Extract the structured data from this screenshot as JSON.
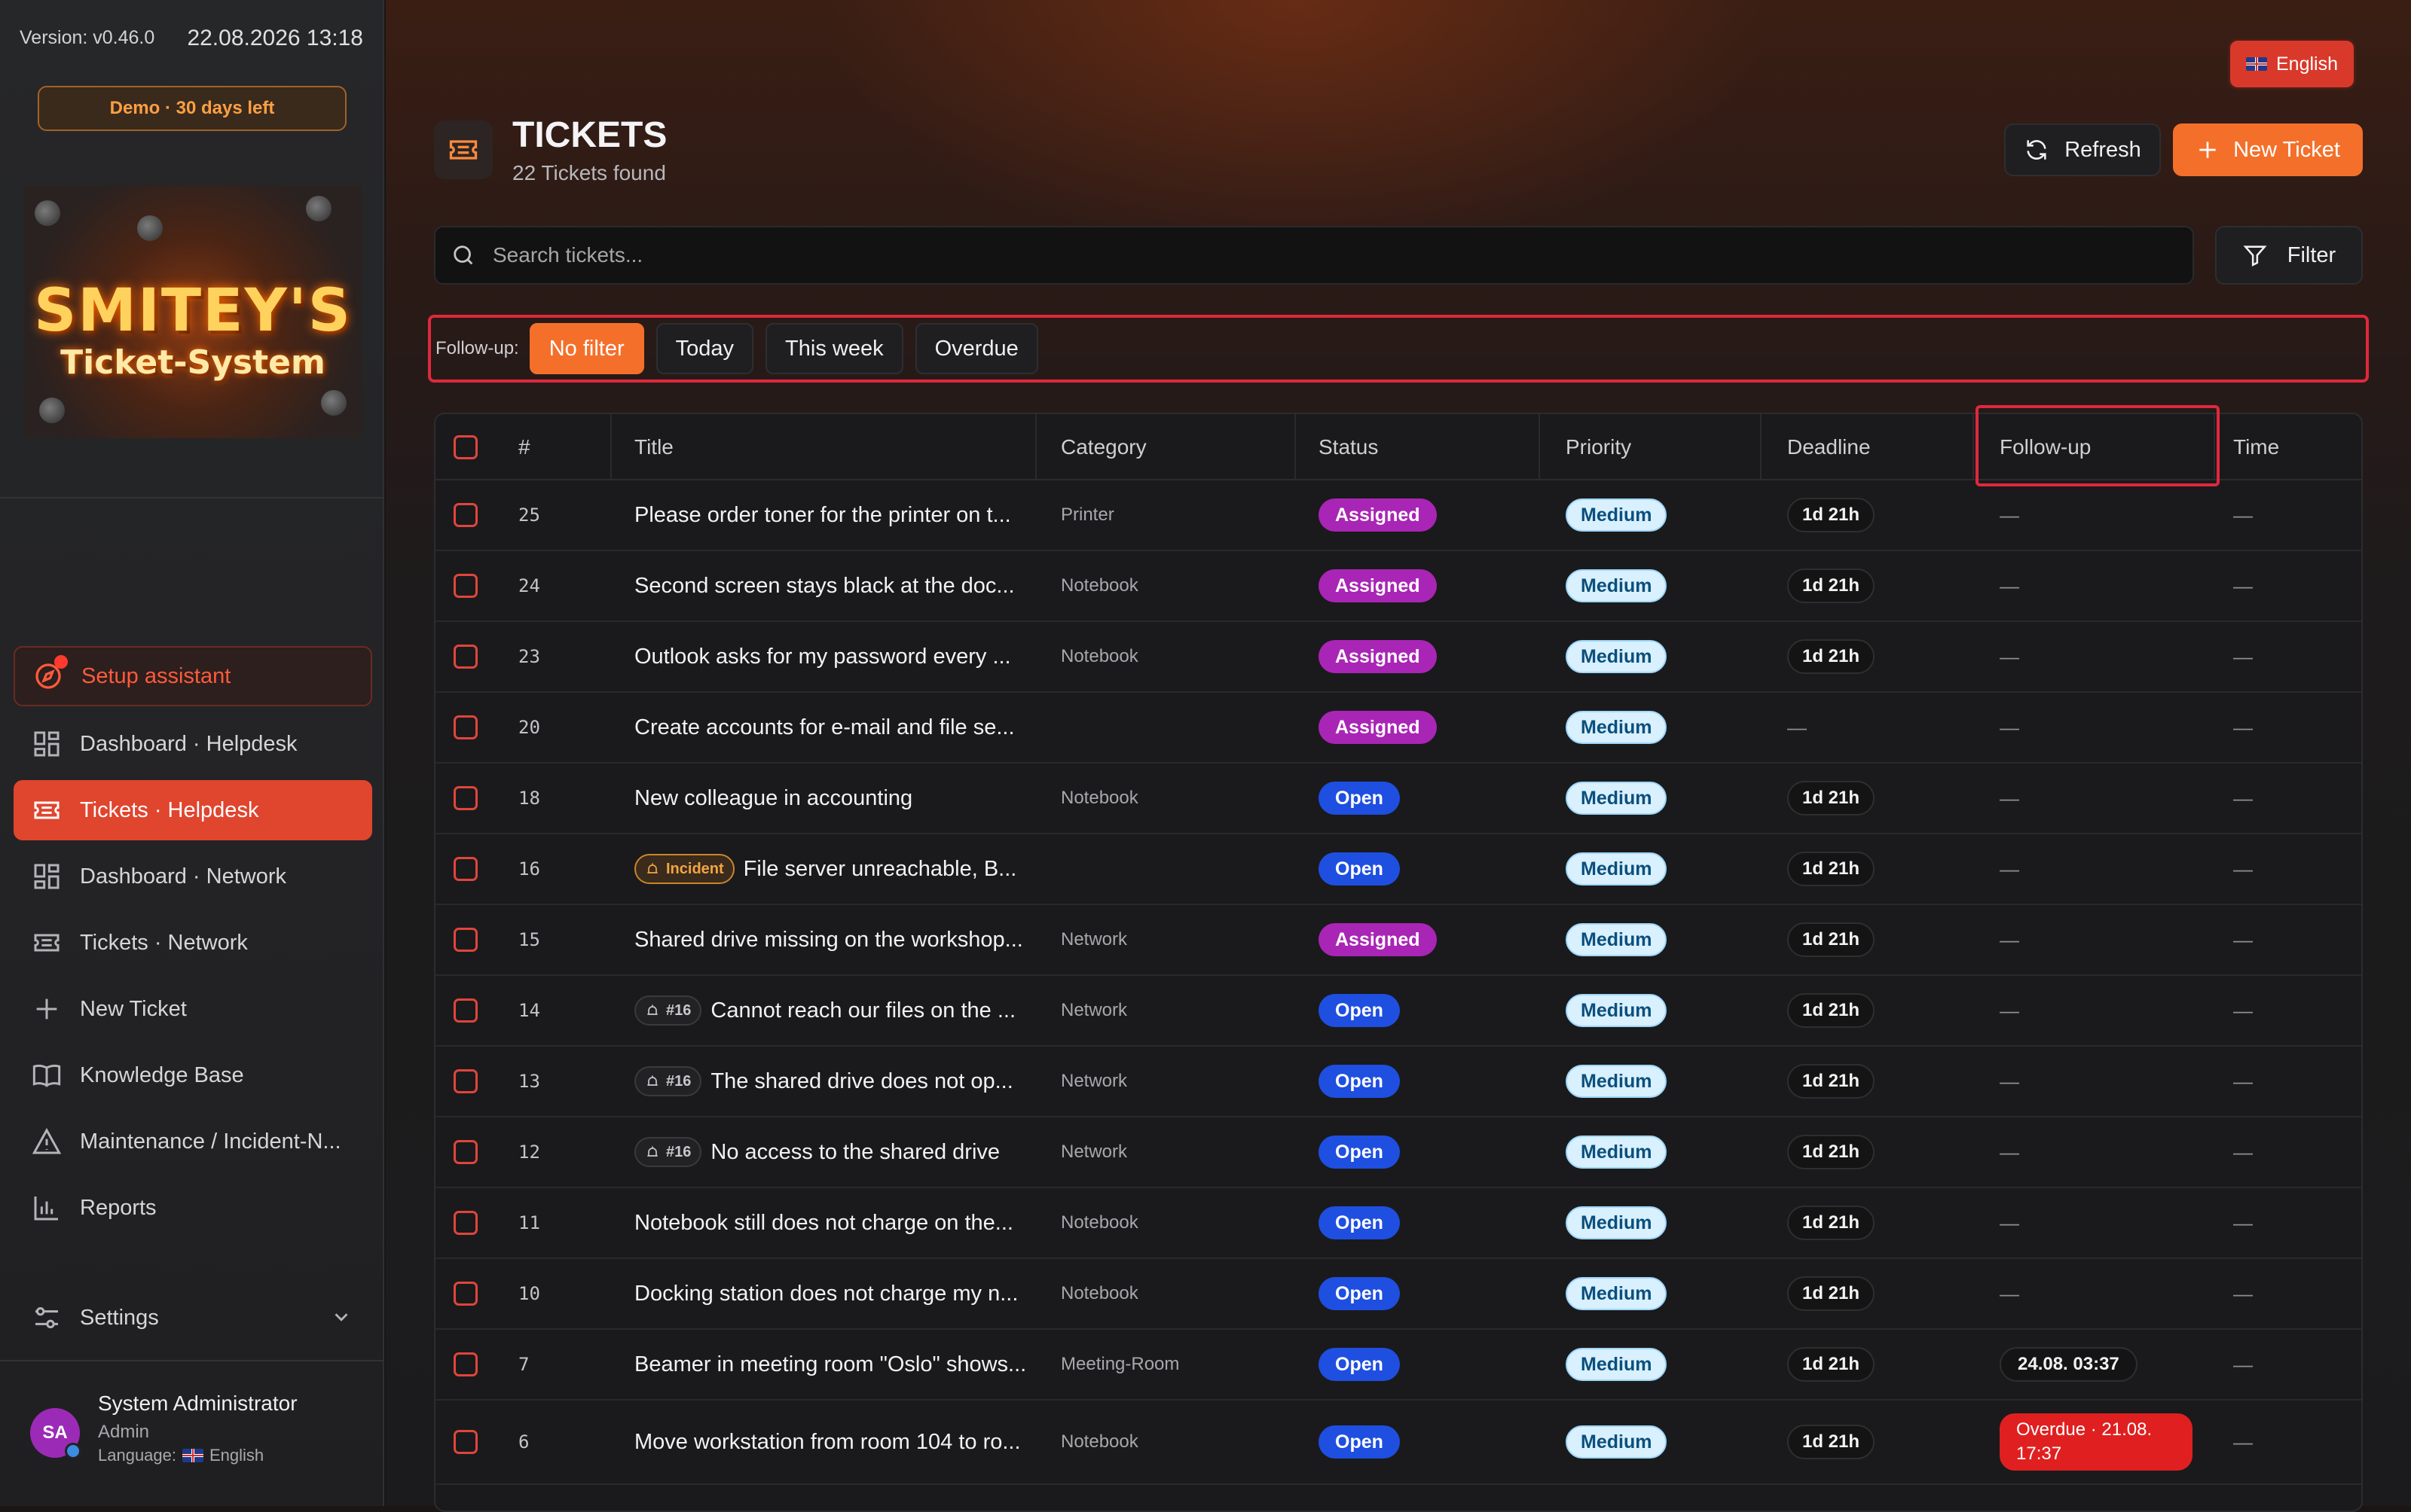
{
  "sidebar": {
    "version": "Version: v0.46.0",
    "datetime": "22.08.2026  13:18",
    "demo_badge": "Demo · 30 days left",
    "logo": {
      "line1": "SMITEY'S",
      "line2": "Ticket-System"
    },
    "setup": {
      "label": "Setup assistant",
      "icon": "compass-icon"
    },
    "nav": [
      {
        "label": "Dashboard · Helpdesk",
        "icon": "dashboard-icon",
        "active": false
      },
      {
        "label": "Tickets · Helpdesk",
        "icon": "ticket-icon",
        "active": true
      },
      {
        "label": "Dashboard · Network",
        "icon": "dashboard-icon",
        "active": false
      },
      {
        "label": "Tickets · Network",
        "icon": "ticket-icon",
        "active": false
      },
      {
        "label": "New Ticket",
        "icon": "plus-icon",
        "active": false
      },
      {
        "label": "Knowledge Base",
        "icon": "book-icon",
        "active": false
      },
      {
        "label": "Maintenance / Incident-N...",
        "icon": "warning-icon",
        "active": false
      },
      {
        "label": "Reports",
        "icon": "bar-chart-icon",
        "active": false
      }
    ],
    "settings": {
      "label": "Settings",
      "icon": "settings-sliders-icon"
    },
    "user": {
      "initials": "SA",
      "name": "System Administrator",
      "role": "Admin",
      "language_label": "Language:",
      "language": "English"
    }
  },
  "header": {
    "language_button": "English",
    "title": "TICKETS",
    "subtitle": "22 Tickets found",
    "refresh_label": "Refresh",
    "new_ticket_label": "New Ticket",
    "search_placeholder": "Search tickets...",
    "filter_label": "Filter"
  },
  "followup_filter": {
    "label": "Follow-up:",
    "options": [
      "No filter",
      "Today",
      "This week",
      "Overdue"
    ],
    "selected": "No filter"
  },
  "table": {
    "columns": [
      "#",
      "Title",
      "Category",
      "Status",
      "Priority",
      "Deadline",
      "Follow-up",
      "Time"
    ],
    "rows": [
      {
        "id": "25",
        "title": "Please order toner for the printer on t...",
        "category": "Printer",
        "status": "Assigned",
        "priority": "Medium",
        "deadline": "1d 21h",
        "followup": "—",
        "time": "—"
      },
      {
        "id": "24",
        "title": "Second screen stays black at the doc...",
        "category": "Notebook",
        "status": "Assigned",
        "priority": "Medium",
        "deadline": "1d 21h",
        "followup": "—",
        "time": "—"
      },
      {
        "id": "23",
        "title": "Outlook asks for my password every ...",
        "category": "Notebook",
        "status": "Assigned",
        "priority": "Medium",
        "deadline": "1d 21h",
        "followup": "—",
        "time": "—"
      },
      {
        "id": "20",
        "title": "Create accounts for e-mail and file se...",
        "category": "",
        "status": "Assigned",
        "priority": "Medium",
        "deadline": "—",
        "followup": "—",
        "time": "—"
      },
      {
        "id": "18",
        "title": "New colleague in accounting",
        "category": "Notebook",
        "status": "Open",
        "priority": "Medium",
        "deadline": "1d 21h",
        "followup": "—",
        "time": "—"
      },
      {
        "id": "16",
        "tag": "Incident",
        "title": "File server unreachable, B...",
        "category": "",
        "status": "Open",
        "priority": "Medium",
        "deadline": "1d 21h",
        "followup": "—",
        "time": "—"
      },
      {
        "id": "15",
        "title": "Shared drive missing on the workshop...",
        "category": "Network",
        "status": "Assigned",
        "priority": "Medium",
        "deadline": "1d 21h",
        "followup": "—",
        "time": "—"
      },
      {
        "id": "14",
        "ref": "#16",
        "title": "Cannot reach our files on the ...",
        "category": "Network",
        "status": "Open",
        "priority": "Medium",
        "deadline": "1d 21h",
        "followup": "—",
        "time": "—"
      },
      {
        "id": "13",
        "ref": "#16",
        "title": "The shared drive does not op...",
        "category": "Network",
        "status": "Open",
        "priority": "Medium",
        "deadline": "1d 21h",
        "followup": "—",
        "time": "—"
      },
      {
        "id": "12",
        "ref": "#16",
        "title": "No access to the shared drive",
        "category": "Network",
        "status": "Open",
        "priority": "Medium",
        "deadline": "1d 21h",
        "followup": "—",
        "time": "—"
      },
      {
        "id": "11",
        "title": "Notebook still does not charge on the...",
        "category": "Notebook",
        "status": "Open",
        "priority": "Medium",
        "deadline": "1d 21h",
        "followup": "—",
        "time": "—"
      },
      {
        "id": "10",
        "title": "Docking station does not charge my n...",
        "category": "Notebook",
        "status": "Open",
        "priority": "Medium",
        "deadline": "1d 21h",
        "followup": "—",
        "time": "—"
      },
      {
        "id": "7",
        "title": "Beamer in meeting room \"Oslo\" shows...",
        "category": "Meeting-Room",
        "status": "Open",
        "priority": "Medium",
        "deadline": "1d 21h",
        "followup": "24.08. 03:37",
        "time": "—"
      },
      {
        "id": "6",
        "title": "Move workstation from room 104 to ro...",
        "category": "Notebook",
        "status": "Open",
        "priority": "Medium",
        "deadline": "1d 21h",
        "followup": "Overdue · 21.08. 17:37",
        "followup_overdue": true,
        "time": "—"
      }
    ]
  },
  "colors": {
    "accent": "#f4702a",
    "active_nav": "#e0452e",
    "highlight_border": "#e0283c",
    "status_assigned": "#a925b5",
    "status_open": "#1f4fe0",
    "overdue": "#e02020"
  }
}
